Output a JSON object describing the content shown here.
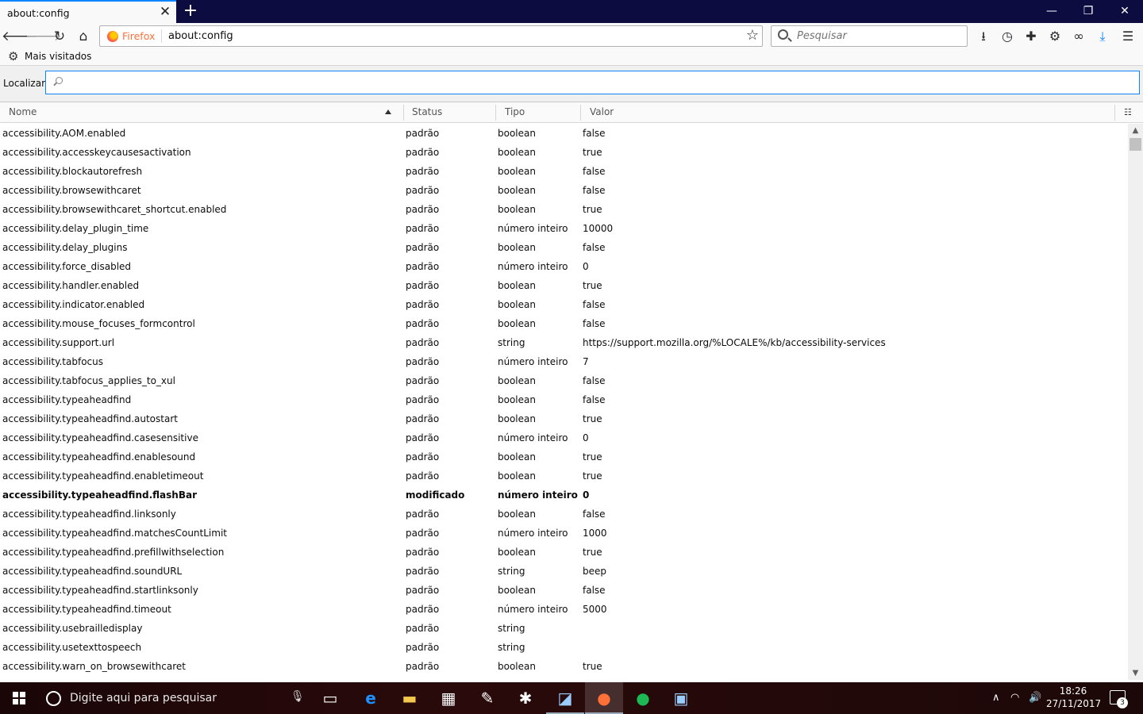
{
  "browser": {
    "tab_title": "about:config",
    "tab_close": "✕",
    "new_tab": "+",
    "url_identity": "Firefox",
    "url": "about:config",
    "search_placeholder": "Pesquisar",
    "bookmark_item": "Mais visitados"
  },
  "window_controls": {
    "minimize": "—",
    "restore": "❐",
    "close": "✕"
  },
  "config": {
    "find_label": "Localizar:",
    "find_value": "",
    "columns": {
      "name": "Nome",
      "status": "Status",
      "type": "Tipo",
      "value": "Valor"
    },
    "rows": [
      {
        "name": "accessibility.AOM.enabled",
        "status": "padrão",
        "type": "boolean",
        "value": "false"
      },
      {
        "name": "accessibility.accesskeycausesactivation",
        "status": "padrão",
        "type": "boolean",
        "value": "true"
      },
      {
        "name": "accessibility.blockautorefresh",
        "status": "padrão",
        "type": "boolean",
        "value": "false"
      },
      {
        "name": "accessibility.browsewithcaret",
        "status": "padrão",
        "type": "boolean",
        "value": "false"
      },
      {
        "name": "accessibility.browsewithcaret_shortcut.enabled",
        "status": "padrão",
        "type": "boolean",
        "value": "true"
      },
      {
        "name": "accessibility.delay_plugin_time",
        "status": "padrão",
        "type": "número inteiro",
        "value": "10000"
      },
      {
        "name": "accessibility.delay_plugins",
        "status": "padrão",
        "type": "boolean",
        "value": "false"
      },
      {
        "name": "accessibility.force_disabled",
        "status": "padrão",
        "type": "número inteiro",
        "value": "0"
      },
      {
        "name": "accessibility.handler.enabled",
        "status": "padrão",
        "type": "boolean",
        "value": "true"
      },
      {
        "name": "accessibility.indicator.enabled",
        "status": "padrão",
        "type": "boolean",
        "value": "false"
      },
      {
        "name": "accessibility.mouse_focuses_formcontrol",
        "status": "padrão",
        "type": "boolean",
        "value": "false"
      },
      {
        "name": "accessibility.support.url",
        "status": "padrão",
        "type": "string",
        "value": "https://support.mozilla.org/%LOCALE%/kb/accessibility-services"
      },
      {
        "name": "accessibility.tabfocus",
        "status": "padrão",
        "type": "número inteiro",
        "value": "7"
      },
      {
        "name": "accessibility.tabfocus_applies_to_xul",
        "status": "padrão",
        "type": "boolean",
        "value": "false"
      },
      {
        "name": "accessibility.typeaheadfind",
        "status": "padrão",
        "type": "boolean",
        "value": "false"
      },
      {
        "name": "accessibility.typeaheadfind.autostart",
        "status": "padrão",
        "type": "boolean",
        "value": "true"
      },
      {
        "name": "accessibility.typeaheadfind.casesensitive",
        "status": "padrão",
        "type": "número inteiro",
        "value": "0"
      },
      {
        "name": "accessibility.typeaheadfind.enablesound",
        "status": "padrão",
        "type": "boolean",
        "value": "true"
      },
      {
        "name": "accessibility.typeaheadfind.enabletimeout",
        "status": "padrão",
        "type": "boolean",
        "value": "true"
      },
      {
        "name": "accessibility.typeaheadfind.flashBar",
        "status": "modificado",
        "type": "número inteiro",
        "value": "0",
        "modified": true
      },
      {
        "name": "accessibility.typeaheadfind.linksonly",
        "status": "padrão",
        "type": "boolean",
        "value": "false"
      },
      {
        "name": "accessibility.typeaheadfind.matchesCountLimit",
        "status": "padrão",
        "type": "número inteiro",
        "value": "1000"
      },
      {
        "name": "accessibility.typeaheadfind.prefillwithselection",
        "status": "padrão",
        "type": "boolean",
        "value": "true"
      },
      {
        "name": "accessibility.typeaheadfind.soundURL",
        "status": "padrão",
        "type": "string",
        "value": "beep"
      },
      {
        "name": "accessibility.typeaheadfind.startlinksonly",
        "status": "padrão",
        "type": "boolean",
        "value": "false"
      },
      {
        "name": "accessibility.typeaheadfind.timeout",
        "status": "padrão",
        "type": "número inteiro",
        "value": "5000"
      },
      {
        "name": "accessibility.usebrailledisplay",
        "status": "padrão",
        "type": "string",
        "value": ""
      },
      {
        "name": "accessibility.usetexttospeech",
        "status": "padrão",
        "type": "string",
        "value": ""
      },
      {
        "name": "accessibility.warn_on_browsewithcaret",
        "status": "padrão",
        "type": "boolean",
        "value": "true"
      }
    ]
  },
  "taskbar": {
    "search_placeholder": "Digite aqui para pesquisar",
    "time": "18:26",
    "date": "27/11/2017",
    "notification_count": "3"
  },
  "colors": {
    "tabstrip": "#0c0c40",
    "accent": "#0a84ff",
    "firefox_orange": "#ff7139"
  }
}
